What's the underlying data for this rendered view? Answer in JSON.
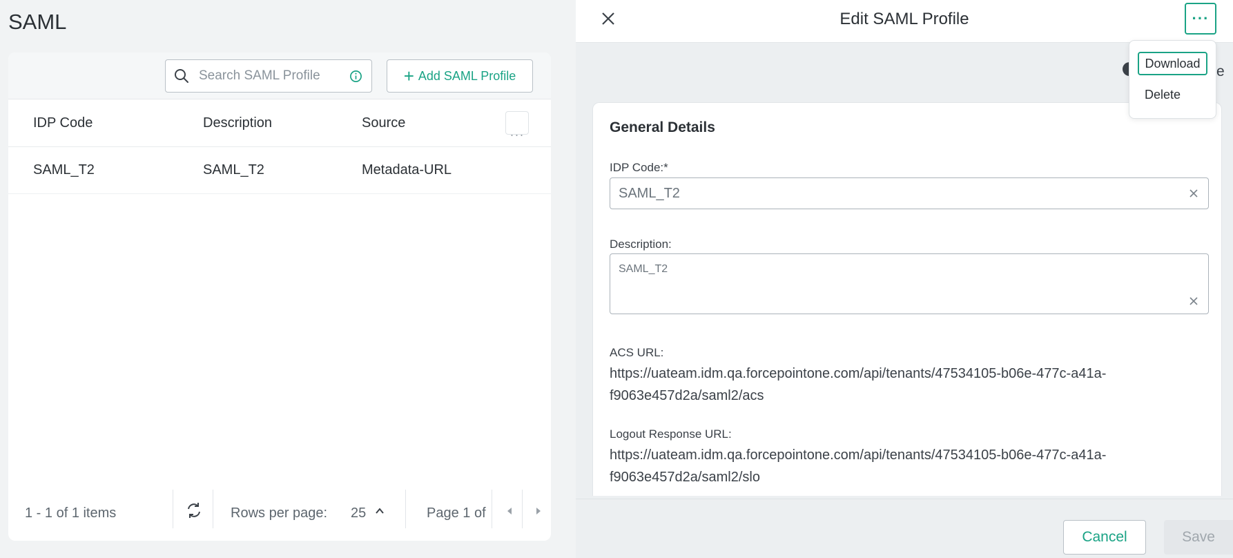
{
  "page": {
    "title": "SAML"
  },
  "toolbar": {
    "search_placeholder": "Search SAML Profile",
    "add_label": "Add SAML Profile"
  },
  "table": {
    "columns": [
      "IDP Code",
      "Description",
      "Source"
    ],
    "rows": [
      {
        "idp_code": "SAML_T2",
        "description": "SAML_T2",
        "source": "Metadata-URL"
      }
    ]
  },
  "pager": {
    "items_text": "1 - 1 of 1 items",
    "rows_per_page_label": "Rows per page:",
    "rows_per_page_value": "25",
    "page_text": "Page 1 of"
  },
  "panel": {
    "title": "Edit SAML Profile",
    "toggle_partial_text": "e",
    "menu": {
      "download": "Download",
      "delete": "Delete"
    },
    "section_title": "General Details",
    "idp_code_label": "IDP Code:*",
    "idp_code_value": "SAML_T2",
    "description_label": "Description:",
    "description_value": "SAML_T2",
    "acs_label": "ACS URL:",
    "acs_value": "https://uateam.idm.qa.forcepointone.com/api/tenants/47534105-b06e-477c-a41a-f9063e457d2a/saml2/acs",
    "logout_label": "Logout Response URL:",
    "logout_value": "https://uateam.idm.qa.forcepointone.com/api/tenants/47534105-b06e-477c-a41a-f9063e457d2a/saml2/slo",
    "cancel_label": "Cancel",
    "save_label": "Save"
  },
  "colors": {
    "accent": "#1aa385",
    "text": "#2b3035",
    "muted": "#8a939b"
  }
}
